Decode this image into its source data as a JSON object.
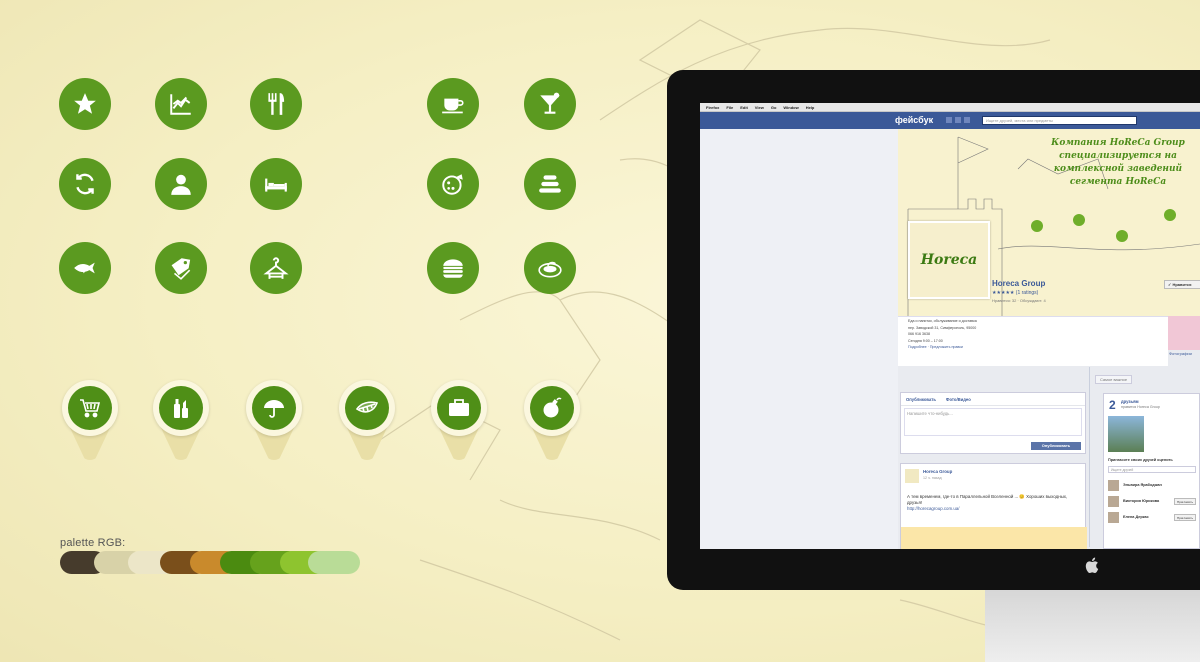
{
  "colors": {
    "icon_green": "#5b9a20",
    "pin_green": "#4f8f17",
    "background": "#f5efc4"
  },
  "icons_grid": [
    "star-icon",
    "chart-icon",
    "fork-knife-icon",
    "coffee-cup-icon",
    "cocktail-icon",
    "refresh-icon",
    "person-icon",
    "bed-icon",
    "pizza-icon",
    "stack-icon",
    "fish-icon",
    "tag-icon",
    "hanger-icon",
    "burger-icon",
    "plate-icon"
  ],
  "pins": [
    "cart-icon",
    "cosmetics-icon",
    "umbrella-icon",
    "leaf-icon",
    "suitcase-icon",
    "bomb-icon"
  ],
  "palette": {
    "label": "palette RGB:",
    "colors": [
      "#463b2c",
      "#d8d2a8",
      "#ece6c8",
      "#7a4f1b",
      "#c98a2c",
      "#4b8b10",
      "#66a21c",
      "#8ec42f",
      "#b9dc97"
    ]
  },
  "facebook": {
    "mac_menu": [
      "Firefox",
      "File",
      "Edit",
      "View",
      "Go",
      "Window",
      "Help"
    ],
    "logo": "фейсбук",
    "search_placeholder": "Ищите друзей, места или предметы",
    "cover_title": "Компания HoReCa Group специализируется на комплексной заведений сегмента HoReCa",
    "profile_logo": "Horeca",
    "page_name": "Horeca Group",
    "stars": "★★★★★ (1 ratings)",
    "likes": "Нравится: 32 · Обсуждают: 4",
    "like_button": "✓ Нравится",
    "info_lines": [
      "Еда и напитки, обслуживание и доставка",
      "пер. Заводской 31, Симферополь, 95000",
      "066 916 3638",
      "Сегодня 9:00 – 17:00"
    ],
    "info_links": "Подробнее · Предложить правки",
    "photos_label": "Фотографии",
    "mode": "Самое важное",
    "composer_tabs": [
      "Опубликовать",
      "Фото/Видео"
    ],
    "composer_placeholder": "Напишите что-нибудь...",
    "post_button": "Опубликовать",
    "post": {
      "name": "Horeca Group",
      "time": "12 ч. назад",
      "text": "А тем временем, где-то в Параллельной Вселенной ... 😊 Хороших выходных, друзья!",
      "url": "http://horecagroup.com.ua/"
    },
    "friends": {
      "count": "2",
      "label": "друзьям",
      "sub": "нравится Horeca Group",
      "invite": "Пригласите своих друзей оценить",
      "search_placeholder": "Ищите друзей",
      "list": [
        {
          "name": "Эльвира Ярабоджан",
          "button": "Пригласить"
        },
        {
          "name": "Виктория Юрикова",
          "button": "Пригласить"
        },
        {
          "name": "Елена Деркас",
          "button": "Пригласить"
        }
      ]
    }
  }
}
